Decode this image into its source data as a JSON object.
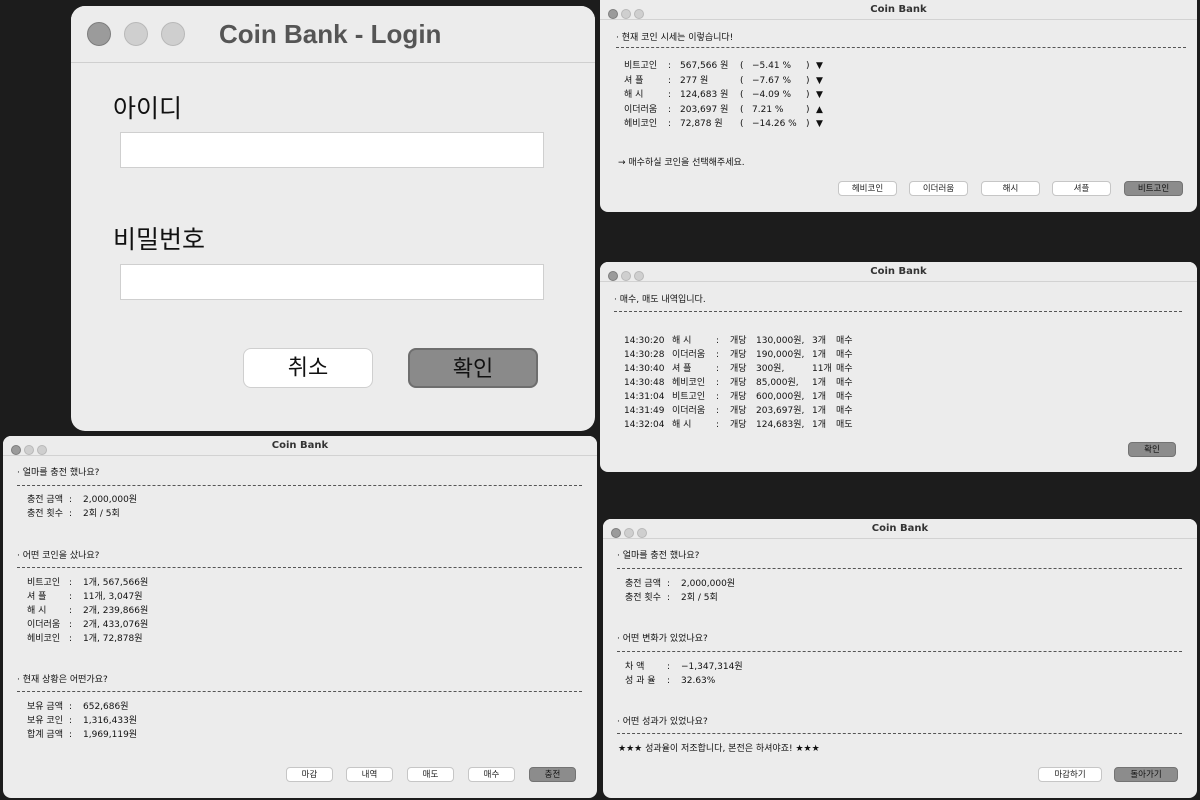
{
  "login": {
    "title": "Coin Bank - Login",
    "id_label": "아이디",
    "id_value": "",
    "pw_label": "비밀번호",
    "pw_value": "",
    "cancel": "취소",
    "confirm": "확인"
  },
  "prices": {
    "title": "Coin Bank",
    "heading": "·  현재 코인 시세는 이렇습니다!",
    "rows": [
      {
        "name": "비트고인",
        "sep": ":",
        "price": "567,566 원",
        "open": "(",
        "pct": "−5.41 %",
        "close": ")",
        "arrow": "▼"
      },
      {
        "name": "셔      플",
        "sep": ":",
        "price": "277 원",
        "open": "(",
        "pct": "−7.67 %",
        "close": ")",
        "arrow": "▼"
      },
      {
        "name": "해      시",
        "sep": ":",
        "price": "124,683 원",
        "open": "(",
        "pct": "−4.09 %",
        "close": ")",
        "arrow": "▼"
      },
      {
        "name": "이더러움",
        "sep": ":",
        "price": "203,697 원",
        "open": "(",
        "pct": "7.21 %",
        "close": ")",
        "arrow": "▲"
      },
      {
        "name": "헤비코인",
        "sep": ":",
        "price": "72,878 원",
        "open": "(",
        "pct": "−14.26 %",
        "close": ")",
        "arrow": "▼"
      }
    ],
    "prompt": "→   매수하실 코인을 선택해주세요.",
    "buttons": [
      "헤비코인",
      "이더러움",
      "해시",
      "셔플",
      "비트고인"
    ]
  },
  "history": {
    "title": "Coin Bank",
    "heading": "·  매수, 매도 내역입니다.",
    "rows": [
      {
        "time": "14:30:20",
        "name": "해      시",
        "sep": ":",
        "unit": "개당",
        "price": "130,000원,",
        "qty": "3개",
        "type": "매수"
      },
      {
        "time": "14:30:28",
        "name": "이더러움",
        "sep": ":",
        "unit": "개당",
        "price": "190,000원,",
        "qty": "1개",
        "type": "매수"
      },
      {
        "time": "14:30:40",
        "name": "셔      플",
        "sep": ":",
        "unit": "개당",
        "price": "300원,",
        "qty": "11개",
        "type": "매수"
      },
      {
        "time": "14:30:48",
        "name": "헤비코인",
        "sep": ":",
        "unit": "개당",
        "price": "85,000원,",
        "qty": "1개",
        "type": "매수"
      },
      {
        "time": "14:31:04",
        "name": "비트고인",
        "sep": ":",
        "unit": "개당",
        "price": "600,000원,",
        "qty": "1개",
        "type": "매수"
      },
      {
        "time": "14:31:49",
        "name": "이더러움",
        "sep": ":",
        "unit": "개당",
        "price": "203,697원,",
        "qty": "1개",
        "type": "매수"
      },
      {
        "time": "14:32:04",
        "name": "해      시",
        "sep": ":",
        "unit": "개당",
        "price": "124,683원,",
        "qty": "1개",
        "type": "매도"
      }
    ],
    "confirm": "확인"
  },
  "status": {
    "title": "Coin Bank",
    "charge_heading": "·  얼마를 충전 했나요?",
    "charge_rows": [
      {
        "label": "충전 금액",
        "sep": ":",
        "value": "2,000,000원"
      },
      {
        "label": "충전 횟수",
        "sep": ":",
        "value": "2회 / 5회"
      }
    ],
    "coins_heading": "·  어떤 코인을 샀나요?",
    "coin_rows": [
      {
        "label": "비트고인",
        "sep": ":",
        "value": "1개, 567,566원"
      },
      {
        "label": "셔      플",
        "sep": ":",
        "value": "11개, 3,047원"
      },
      {
        "label": "해      시",
        "sep": ":",
        "value": "2개, 239,866원"
      },
      {
        "label": "이더러움",
        "sep": ":",
        "value": "2개, 433,076원"
      },
      {
        "label": "헤비코인",
        "sep": ":",
        "value": "1개, 72,878원"
      }
    ],
    "now_heading": "·  현재 상황은 어떤가요?",
    "now_rows": [
      {
        "label": "보유 금액",
        "sep": ":",
        "value": "652,686원"
      },
      {
        "label": "보유 코인",
        "sep": ":",
        "value": "1,316,433원"
      },
      {
        "label": "합계 금액",
        "sep": ":",
        "value": "1,969,119원"
      }
    ],
    "buttons": [
      "마감",
      "내역",
      "매도",
      "매수",
      "충전"
    ]
  },
  "result": {
    "title": "Coin Bank",
    "charge_heading": "·  얼마를 충전 했나요?",
    "charge_rows": [
      {
        "label": "충전 금액",
        "sep": ":",
        "value": "2,000,000원"
      },
      {
        "label": "충전 횟수",
        "sep": ":",
        "value": "2회 / 5회"
      }
    ],
    "change_heading": "·  어떤 변화가 있었나요?",
    "change_rows": [
      {
        "label": "차      액",
        "sep": ":",
        "value": "−1,347,314원"
      },
      {
        "label": "성  과  율",
        "sep": ":",
        "value": "32.63%"
      }
    ],
    "perf_heading": "·  어떤 성과가 있었나요?",
    "perf_text": "★★★   성과율이 저조합니다,    본전은 하셔야죠!    ★★★",
    "buttons": [
      "마감하기",
      "돌아가기"
    ]
  }
}
